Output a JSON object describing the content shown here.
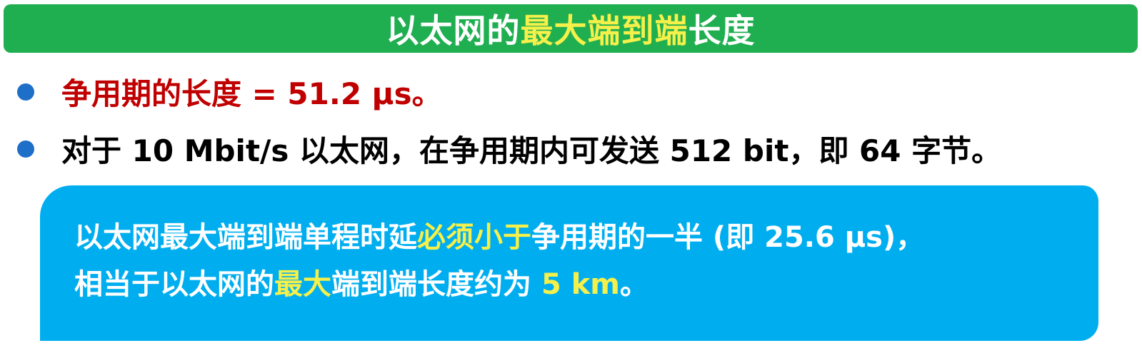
{
  "title": {
    "part1": "以太网的",
    "part2": "最大端到端",
    "part3": "长度"
  },
  "bullets": [
    {
      "text": "争用期的长度 = 51.2 μs。"
    },
    {
      "text": "对于 10 Mbit/s 以太网，在争用期内可发送 512 bit，即 64 字节。"
    }
  ],
  "info_box": {
    "line1": {
      "part1": "以太网最大端到端单程时延",
      "part2": "必须小于",
      "part3": "争用期的一半 (即 25.6 μs)，"
    },
    "line2": {
      "part1": "相当于以太网的",
      "part2": "最大",
      "part3": "端到端长度约为 ",
      "part4": "5 km",
      "part5": "。"
    }
  },
  "colors": {
    "title_bg": "#1fae50",
    "highlight": "#f5f04a",
    "bullet_red": "#c00000",
    "bullet_dot": "#1e6fc7",
    "info_bg": "#00aef0"
  }
}
